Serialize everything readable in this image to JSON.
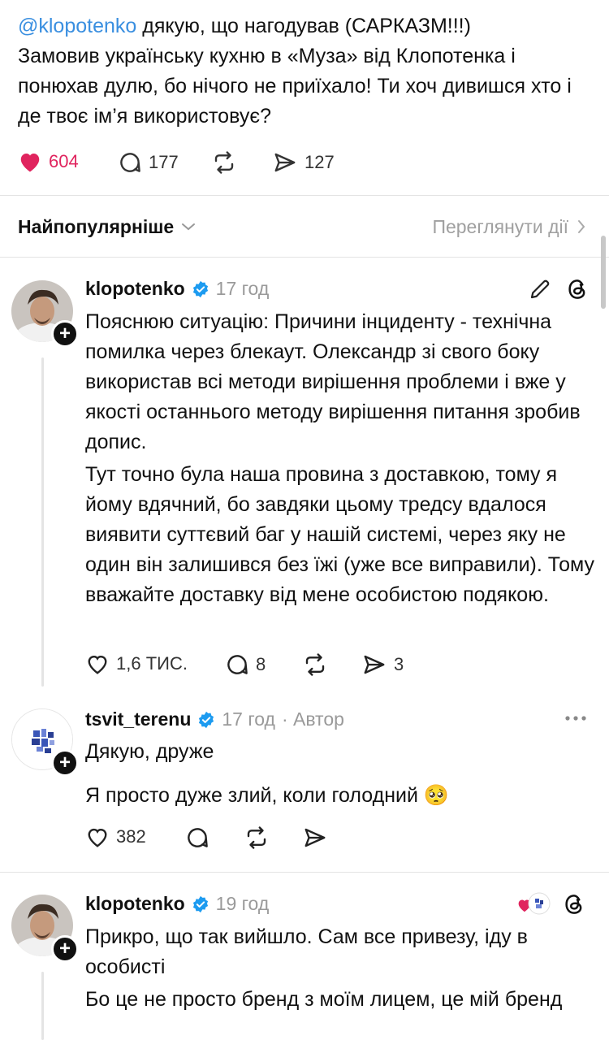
{
  "post": {
    "mention": "@klopotenko",
    "line1_rest": " дякую, що нагодував (САРКАЗМ!!!)",
    "line2": "Замовив українську кухню в «Муза» від Клопотенка і понюхав дулю, бо нічого не приїхало! Ти хоч дивишся хто і де твоє ім’я використовує?",
    "likes": "604",
    "replies": "177",
    "shares": "127",
    "like_color": "#e0245e"
  },
  "sort": {
    "label": "Найпопулярніше",
    "view_activity": "Переглянути дії"
  },
  "comments": [
    {
      "username": "klopotenko",
      "time": "17 год",
      "paragraphs": [
        "Пояснюю ситуацію: Причини інциденту - технічна помилка через блекаут. Олександр зі свого боку використав всі методи вирішення проблеми і вже у якості останнього методу вирішення питання зробив допис.",
        "Тут точно була наша провина з доставкою, тому я йому вдячний, бо завдяки цьому тредсу вдалося виявити суттєвий баг у нашій системі, через яку не один він залишився без їжі (уже все виправили). Тому вважайте доставку від мене особистою подякою."
      ],
      "likes": "1,6 ТИС.",
      "replies": "8",
      "shares": "3"
    },
    {
      "username": "tsvit_terenu",
      "time": "17 год",
      "author_tag": "· Автор",
      "paragraphs": [
        "Дякую, друже",
        "Я просто дуже злий, коли голодний 🥺"
      ],
      "likes": "382"
    },
    {
      "username": "klopotenko",
      "time": "19 год",
      "paragraphs": [
        "Прикро, що так вийшло. Сам все привезу, іду в особисті",
        "Бо це не просто бренд з моїм лицем, це мій бренд"
      ]
    }
  ],
  "icons": {
    "verified": "verified-badge-icon",
    "edit": "pencil-icon",
    "threads": "threads-logo-icon",
    "more": "more-dots-icon",
    "verified_color": "#1d9bf0"
  }
}
